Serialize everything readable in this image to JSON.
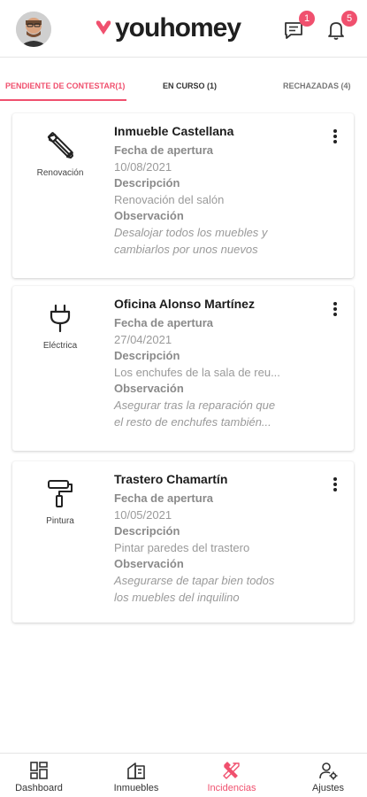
{
  "header": {
    "brand": "youhomey",
    "brand_color": "#f0506e",
    "messages_badge": "1",
    "notifications_badge": "5"
  },
  "tabs": [
    {
      "label": "PENDIENTE DE CONTESTAR(1)",
      "active": true
    },
    {
      "label": "EN CURSO (1)",
      "active": false
    },
    {
      "label": "RECHAZADAS (4)",
      "active": false
    }
  ],
  "labels": {
    "fecha": "Fecha de apertura",
    "descripcion": "Descripción",
    "observacion": "Observación"
  },
  "cards": [
    {
      "category": "Renovación",
      "category_icon": "tools-icon",
      "title": "Inmueble Castellana",
      "fecha": "10/08/2021",
      "descripcion": "Renovación del salón",
      "observacion_1": "Desalojar todos los muebles y",
      "observacion_2": "cambiarlos por unos nuevos"
    },
    {
      "category": "Eléctrica",
      "category_icon": "plug-icon",
      "title": "Oficina Alonso Martínez",
      "fecha": "27/04/2021",
      "descripcion": "Los enchufes de la sala de reu...",
      "observacion_1": "Asegurar tras la reparación que",
      "observacion_2": " el resto de enchufes también..."
    },
    {
      "category": "Pintura",
      "category_icon": "paint-roller-icon",
      "title": "Trastero Chamartín",
      "fecha": "10/05/2021",
      "descripcion": "Pintar paredes del trastero",
      "observacion_1": "Asegurarse de tapar bien todos",
      "observacion_2": "los muebles del inquilino"
    }
  ],
  "bottom_nav": [
    {
      "label": "Dashboard",
      "icon": "dashboard-icon",
      "active": false
    },
    {
      "label": "Inmuebles",
      "icon": "building-icon",
      "active": false
    },
    {
      "label": "Incidencias",
      "icon": "tools-icon",
      "active": true
    },
    {
      "label": "Ajustes",
      "icon": "user-settings-icon",
      "active": false
    }
  ]
}
